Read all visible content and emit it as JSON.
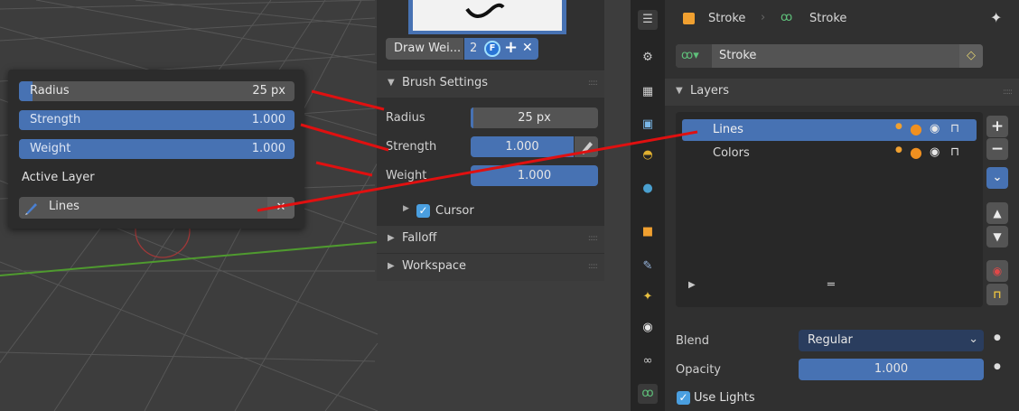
{
  "viewport": {
    "popup": {
      "radius": {
        "label": "Radius",
        "value": "25 px",
        "fill": 0.05
      },
      "strength": {
        "label": "Strength",
        "value": "1.000",
        "fill": 1.0
      },
      "weight": {
        "label": "Weight",
        "value": "1.000",
        "fill": 1.0
      },
      "active_layer_label": "Active Layer",
      "active_layer_value": "Lines"
    }
  },
  "tool_panel": {
    "vertex_group": {
      "name": "Draw Wei...",
      "users": "2",
      "fake_user": "F"
    },
    "brush_settings": {
      "title": "Brush Settings",
      "radius": {
        "label": "Radius",
        "value": "25 px"
      },
      "strength": {
        "label": "Strength",
        "value": "1.000"
      },
      "weight": {
        "label": "Weight",
        "value": "1.000"
      },
      "cursor_label": "Cursor",
      "cursor_checked": true
    },
    "falloff_title": "Falloff",
    "workspace_title": "Workspace"
  },
  "properties": {
    "breadcrumb": {
      "object": "Stroke",
      "data": "Stroke"
    },
    "data_block": "Stroke",
    "layers": {
      "title": "Layers",
      "items": [
        {
          "name": "Lines",
          "selected": true
        },
        {
          "name": "Colors",
          "selected": false
        }
      ]
    },
    "blend": {
      "label": "Blend",
      "value": "Regular"
    },
    "opacity": {
      "label": "Opacity",
      "value": "1.000"
    },
    "use_lights": {
      "label": "Use Lights",
      "checked": true
    }
  },
  "colors": {
    "accent": "#4772b3",
    "annotation": "#e01010",
    "green_axis": "#4f9a2f",
    "red_axis": "#a03838"
  }
}
